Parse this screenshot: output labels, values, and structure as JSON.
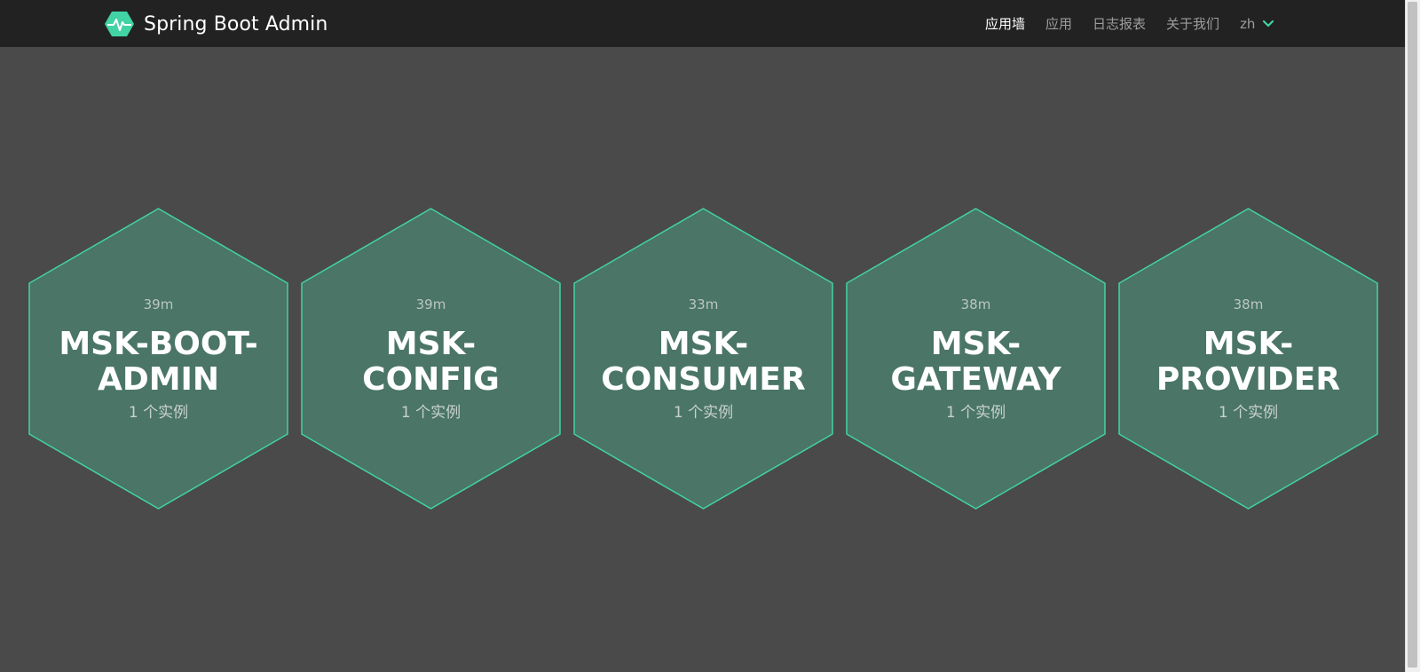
{
  "brand": {
    "title": "Spring Boot Admin",
    "accent": "#42d3a5"
  },
  "nav": {
    "items": [
      {
        "label": "应用墙",
        "active": true
      },
      {
        "label": "应用",
        "active": false
      },
      {
        "label": "日志报表",
        "active": false
      },
      {
        "label": "关于我们",
        "active": false
      }
    ],
    "language": "zh"
  },
  "colors": {
    "hex_fill": "#4a7567",
    "hex_stroke": "#42d3a5",
    "background": "#4a4a4a",
    "navbar": "#222222"
  },
  "applications": [
    {
      "uptime": "39m",
      "name_line1": "MSK-BOOT-",
      "name_line2": "ADMIN",
      "instances": "1 个实例"
    },
    {
      "uptime": "39m",
      "name_line1": "MSK-",
      "name_line2": "CONFIG",
      "instances": "1 个实例"
    },
    {
      "uptime": "33m",
      "name_line1": "MSK-",
      "name_line2": "CONSUMER",
      "instances": "1 个实例"
    },
    {
      "uptime": "38m",
      "name_line1": "MSK-",
      "name_line2": "GATEWAY",
      "instances": "1 个实例"
    },
    {
      "uptime": "38m",
      "name_line1": "MSK-",
      "name_line2": "PROVIDER",
      "instances": "1 个实例"
    }
  ]
}
